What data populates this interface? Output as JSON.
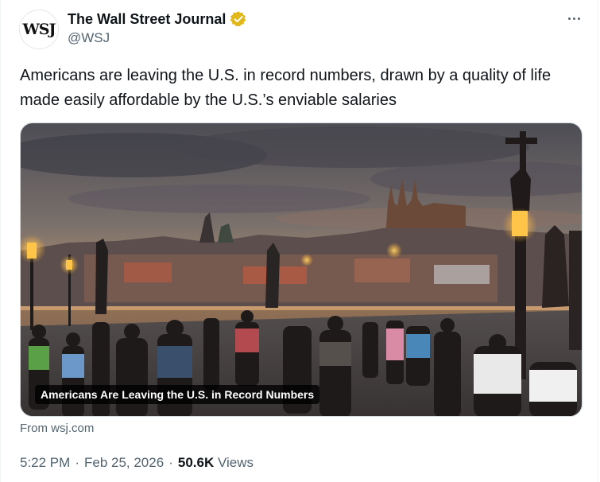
{
  "author": {
    "avatar_text": "WSJ",
    "display_name": "The Wall Street Journal",
    "handle": "@WSJ",
    "verified_color": "#e2b719"
  },
  "more_menu": {
    "icon": "more-horizontal-icon"
  },
  "tweet": {
    "text": "Americans are leaving the U.S. in record numbers, drawn by a quality of life made easily affordable by the U.S.’s enviable salaries"
  },
  "card": {
    "image_caption": "Americans Are Leaving the U.S. in Record Numbers",
    "source": "From wsj.com"
  },
  "meta": {
    "time": "5:22 PM",
    "date": "Feb 25, 2026",
    "views_count": "50.6K",
    "views_label": "Views",
    "separator": "·"
  }
}
